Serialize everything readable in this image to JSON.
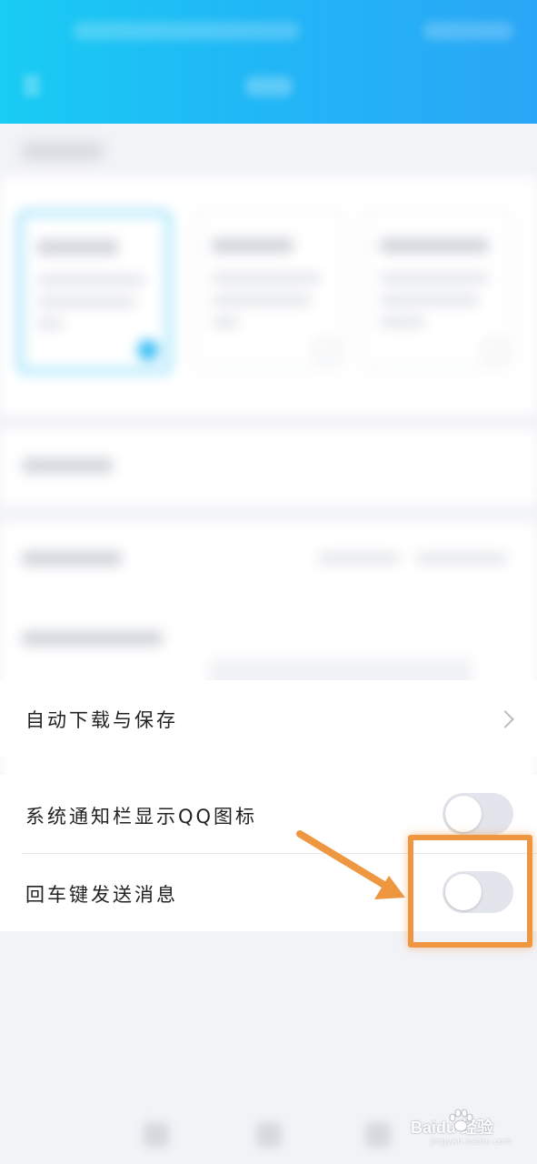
{
  "settings": {
    "auto_download": {
      "label": "自动下载与保存"
    },
    "notif_icon": {
      "label": "系统通知栏显示QQ图标",
      "enabled": false
    },
    "enter_send": {
      "label": "回车键发送消息",
      "enabled": false
    }
  },
  "annotation": {
    "color": "#ee9640"
  },
  "watermark": {
    "brand": "Baidu 经验",
    "sub": "jingyan.baidu.com"
  },
  "colors": {
    "header_gradient_start": "#19ccf3",
    "header_gradient_end": "#2aa6f6",
    "page_background": "#f2f3f7",
    "toggle_off": "#e3e5ec"
  }
}
